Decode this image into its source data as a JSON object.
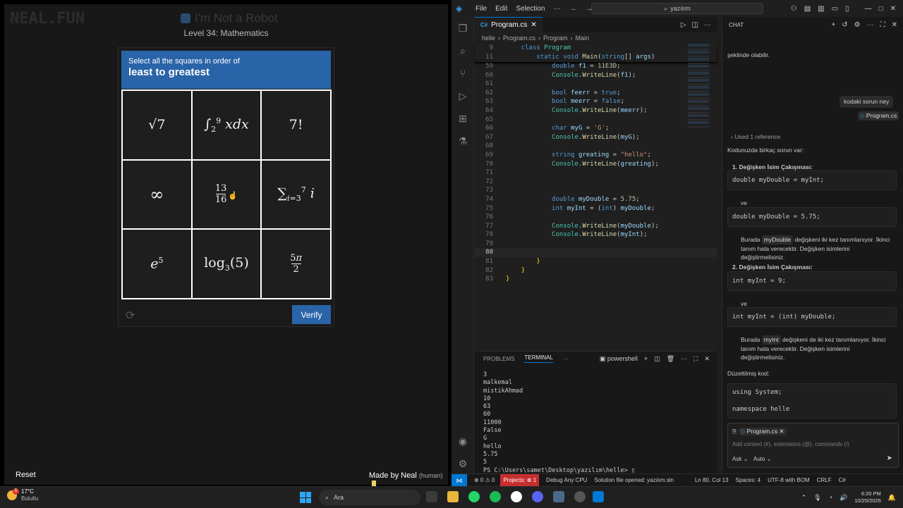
{
  "game": {
    "logo": "NEAL.FUN",
    "title": "I'm Not a Robot",
    "level": "Level 34: Mathematics",
    "instruction_small": "Select all the squares in order of",
    "instruction_big": "least to greatest",
    "tiles": [
      {
        "id": "sqrt7",
        "label": "√7"
      },
      {
        "id": "integral",
        "label": "∫₂⁹ x dx"
      },
      {
        "id": "factorial",
        "label": "7!"
      },
      {
        "id": "infinity",
        "label": "∞"
      },
      {
        "id": "fraction",
        "label": "13/16"
      },
      {
        "id": "sum",
        "label": "Σ i=3..7 i"
      },
      {
        "id": "exp",
        "label": "e⁵"
      },
      {
        "id": "log",
        "label": "log₃(5)"
      },
      {
        "id": "fivepi",
        "label": "5π/2"
      }
    ],
    "verify_label": "Verify",
    "reset_label": "Reset",
    "made_by": "Made by Neal",
    "made_by_tag": "(human)"
  },
  "vscode": {
    "menu": [
      "File",
      "Edit",
      "Selection",
      "···"
    ],
    "search_placeholder": "yazılım",
    "tab_label": "Program.cs",
    "breadcrumb": [
      "helle",
      "Program.cs",
      "Program",
      "Main"
    ],
    "sticky": [
      {
        "ln": "9",
        "code": "    class Program"
      },
      {
        "ln": "11",
        "code": "        static void Main(string[] args)"
      }
    ],
    "code_lines": [
      {
        "ln": "59",
        "html": "            <span class='k'>double</span> <span class='v'>f1</span> = <span class='n'>11E3D</span>;"
      },
      {
        "ln": "60",
        "html": "            <span class='t'>Console</span>.<span class='m'>WriteLine</span>(<span class='v'>f1</span>);"
      },
      {
        "ln": "61",
        "html": ""
      },
      {
        "ln": "62",
        "html": "            <span class='k'>bool</span> <span class='v'>feerr</span> = <span class='k'>true</span>;"
      },
      {
        "ln": "63",
        "html": "            <span class='k'>bool</span> <span class='v'>meerr</span> = <span class='k'>false</span>;"
      },
      {
        "ln": "64",
        "html": "            <span class='t'>Console</span>.<span class='m'>WriteLine</span>(<span class='v'>meerr</span>);"
      },
      {
        "ln": "65",
        "html": ""
      },
      {
        "ln": "66",
        "html": "            <span class='k'>char</span> <span class='v'>myG</span> = <span class='s'>'G'</span>;"
      },
      {
        "ln": "67",
        "html": "            <span class='t'>Console</span>.<span class='m'>WriteLine</span>(<span class='v'>myG</span>);"
      },
      {
        "ln": "68",
        "html": ""
      },
      {
        "ln": "69",
        "html": "            <span class='k'>string</span> <span class='v'>greating</span> = <span class='s'>\"hello\"</span>;"
      },
      {
        "ln": "70",
        "html": "            <span class='t'>Console</span>.<span class='m'>WriteLine</span>(<span class='v'>greating</span>);"
      },
      {
        "ln": "71",
        "html": ""
      },
      {
        "ln": "72",
        "html": ""
      },
      {
        "ln": "73",
        "html": ""
      },
      {
        "ln": "74",
        "html": "            <span class='k'>double</span> <span class='v'>myDouble</span> = <span class='n'>5.75</span>;"
      },
      {
        "ln": "75",
        "html": "            <span class='k'>int</span> <span class='v'>myInt</span> = (<span class='k'>int</span>) <span class='v'>myDouble</span>;"
      },
      {
        "ln": "76",
        "html": ""
      },
      {
        "ln": "77",
        "html": "            <span class='t'>Console</span>.<span class='m'>WriteLine</span>(<span class='v'>myDouble</span>);"
      },
      {
        "ln": "78",
        "html": "            <span class='t'>Console</span>.<span class='m'>WriteLine</span>(<span class='v'>myInt</span>);"
      },
      {
        "ln": "79",
        "html": ""
      },
      {
        "ln": "80",
        "html": ""
      },
      {
        "ln": "81",
        "html": "        <span class='br'>}</span>"
      },
      {
        "ln": "82",
        "html": "    <span class='br'>}</span>"
      },
      {
        "ln": "83",
        "html": "<span class='br'>}</span>"
      }
    ],
    "current_line": "80",
    "panel_tabs": [
      "PROBLEMS",
      "TERMINAL"
    ],
    "terminal_shell": "powershell",
    "terminal_lines": [
      "3",
      "malkemal",
      "mistikAhmad",
      "10",
      "63",
      "60",
      "11000",
      "False",
      "G",
      "hello",
      "5.75",
      "5",
      "PS C:\\Users\\samet\\Desktop\\yazılım\\helle> ▯"
    ],
    "chat": {
      "header": "CHAT",
      "prev_fragment": "şeklinde olabilir.",
      "user_msg": "kodaki sorun ney",
      "user_ref": "Program.cs",
      "used_ref": "Used 1 reference",
      "intro": "Kodunuzda birkaç sorun var:",
      "item1_title": "Değişken İsim Çakışması:",
      "item1_code1": "double myDouble = myInt;",
      "ve1": "ve",
      "item1_code2": "double myDouble = 5.75;",
      "item1_expl_a": "Burada",
      "item1_expl_var": "myDouble",
      "item1_expl_b": "değişkeni iki kez tanımlanıyor. İkinci tanım hata verecektir. Değişken isimlerini değiştirmelisiniz.",
      "item2_title": "Değişken İsim Çakışması:",
      "item2_code1": "int myInt = 9;",
      "ve2": "ve",
      "item2_code2": "int myInt = (int) myDouble;",
      "item2_expl_a": "Burada",
      "item2_expl_var": "myInt",
      "item2_expl_b": "değişkeni de iki kez tanımlanıyor. İkinci tanım hata verecektir. Değişken isimlerini değiştirmelisiniz.",
      "fixed_label": "Düzeltilmiş kod:",
      "fixed_code1": "using System;",
      "fixed_code2": "namespace helle",
      "input_file": "Program.cs",
      "input_placeholder": "Add context (#), extensions (@), commands (/)",
      "mode": "Ask",
      "model": "Auto"
    },
    "status": {
      "errors": "⊗ 0 ⚠ 0",
      "projects": "Projects: ⊗ 1",
      "config": "Debug Any CPU",
      "solution": "Solution file opened: yazılım.sln",
      "position": "Ln 80, Col 13",
      "spaces": "Spaces: 4",
      "encoding": "UTF-8 with BOM",
      "eol": "CRLF",
      "lang": "C#"
    }
  },
  "taskbar": {
    "temp": "17°C",
    "weather": "Bulutlu",
    "weather_badge": "5",
    "search": "Ara",
    "time": "6:20 PM",
    "date": "10/25/2025"
  }
}
